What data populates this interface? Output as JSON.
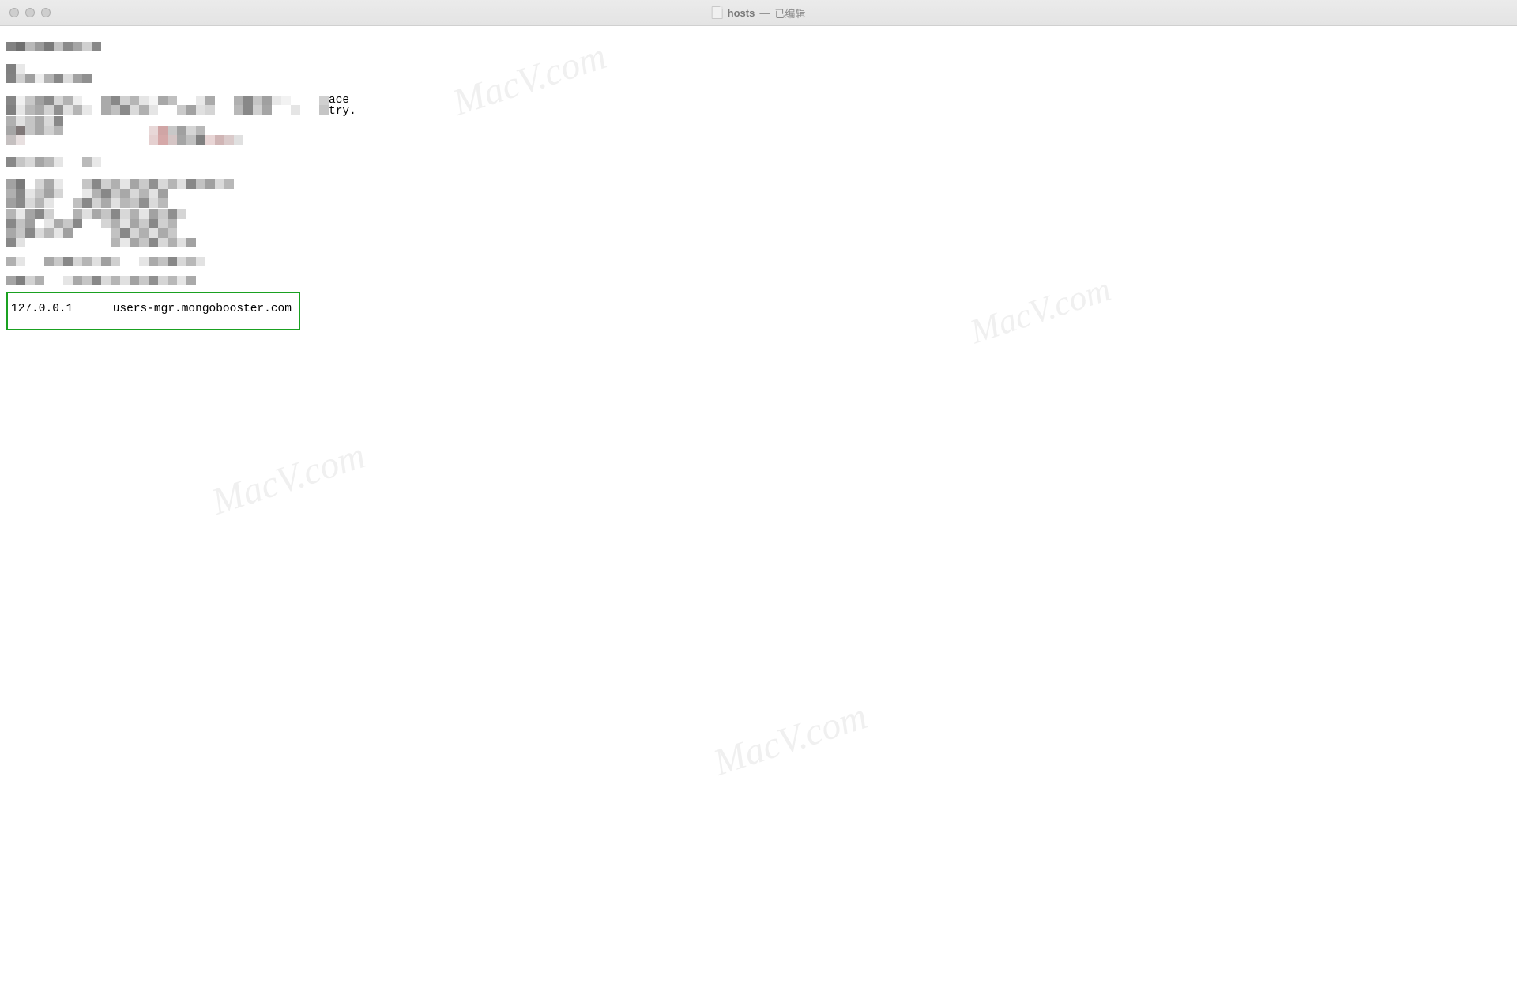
{
  "titlebar": {
    "filename": "hosts",
    "separator": "—",
    "status": "已编辑"
  },
  "content": {
    "visible_fragments": {
      "frag1": "ace",
      "frag2": "try."
    },
    "highlighted": {
      "ip": "127.0.0.1",
      "host": "users-mgr.mongobooster.com"
    }
  },
  "watermark": "MacV.com"
}
